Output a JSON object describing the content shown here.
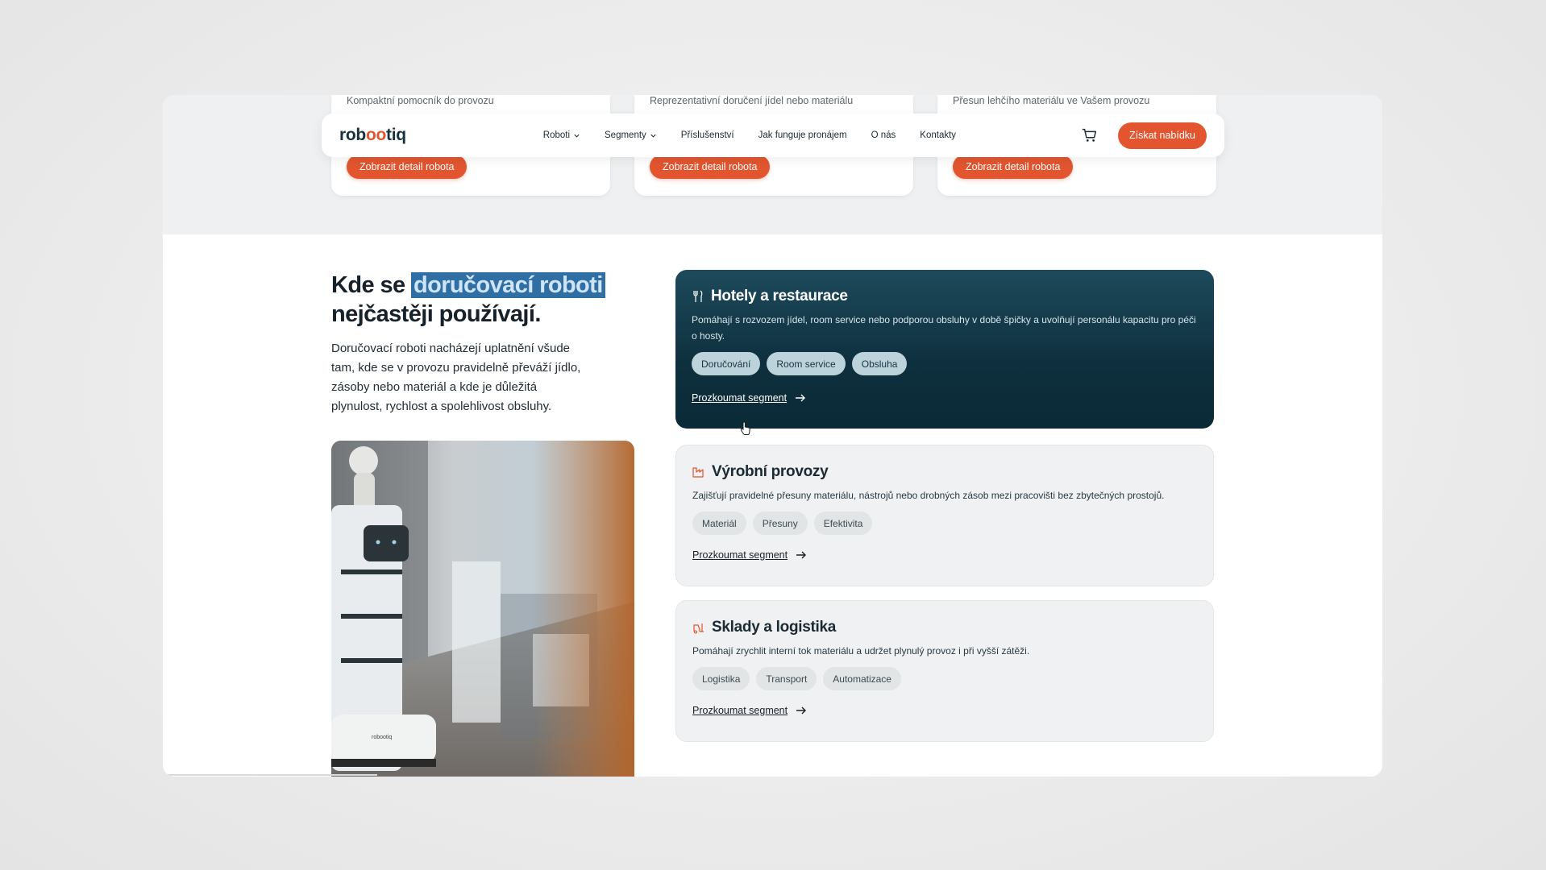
{
  "robot_cards": [
    {
      "desc": "Kompaktní pomocník do provozu",
      "button": "Zobrazit detail robota"
    },
    {
      "desc": "Reprezentativní doručení jídel nebo materiálu",
      "button": "Zobrazit detail robota"
    },
    {
      "desc": "Přesun lehčího materiálu ve Vašem provozu",
      "button": "Zobrazit detail robota"
    }
  ],
  "nav": {
    "logo_pre": "rob",
    "logo_oo": "oo",
    "logo_post": "tiq",
    "links": [
      "Roboti",
      "Segmenty",
      "Příslušenství",
      "Jak funguje pronájem",
      "O nás",
      "Kontakty"
    ],
    "cta": "Získat nabídku"
  },
  "section": {
    "heading_1": "Kde se ",
    "heading_highlight": "doručovací roboti",
    "heading_2": "nejčastěji používají.",
    "intro": "Doručovací roboti nacházejí uplatnění všude tam, kde se v provozu pravidelně převáží jídlo, zásoby nebo materiál a kde je důležitá plynulost, rychlost a spolehlivost obsluhy."
  },
  "segments": [
    {
      "title": "Hotely a restaurace",
      "icon": "cutlery-icon",
      "desc": "Pomáhají s rozvozem jídel, room service nebo podporou obsluhy v době špičky a uvolňují personálu kapacitu pro péči o hosty.",
      "tags": [
        "Doručování",
        "Room service",
        "Obsluha"
      ],
      "link": "Prozkoumat segment"
    },
    {
      "title": "Výrobní provozy",
      "icon": "factory-icon",
      "desc": "Zajišťují pravidelné přesuny materiálu, nástrojů nebo drobných zásob mezi pracovišti bez zbytečných prostojů.",
      "tags": [
        "Materiál",
        "Přesuny",
        "Efektivita"
      ],
      "link": "Prozkoumat segment"
    },
    {
      "title": "Sklady a logistika",
      "icon": "forklift-icon",
      "desc": "Pomáhají zrychlit interní tok materiálu a udržet plynulý provoz i při vyšší zátěži.",
      "tags": [
        "Logistika",
        "Transport",
        "Automatizace"
      ],
      "link": "Prozkoumat segment"
    }
  ],
  "photo_logo": "robootiq",
  "colors": {
    "accent": "#e2552f",
    "dark": "#0e2f3d",
    "highlight": "#2f6fa3"
  }
}
